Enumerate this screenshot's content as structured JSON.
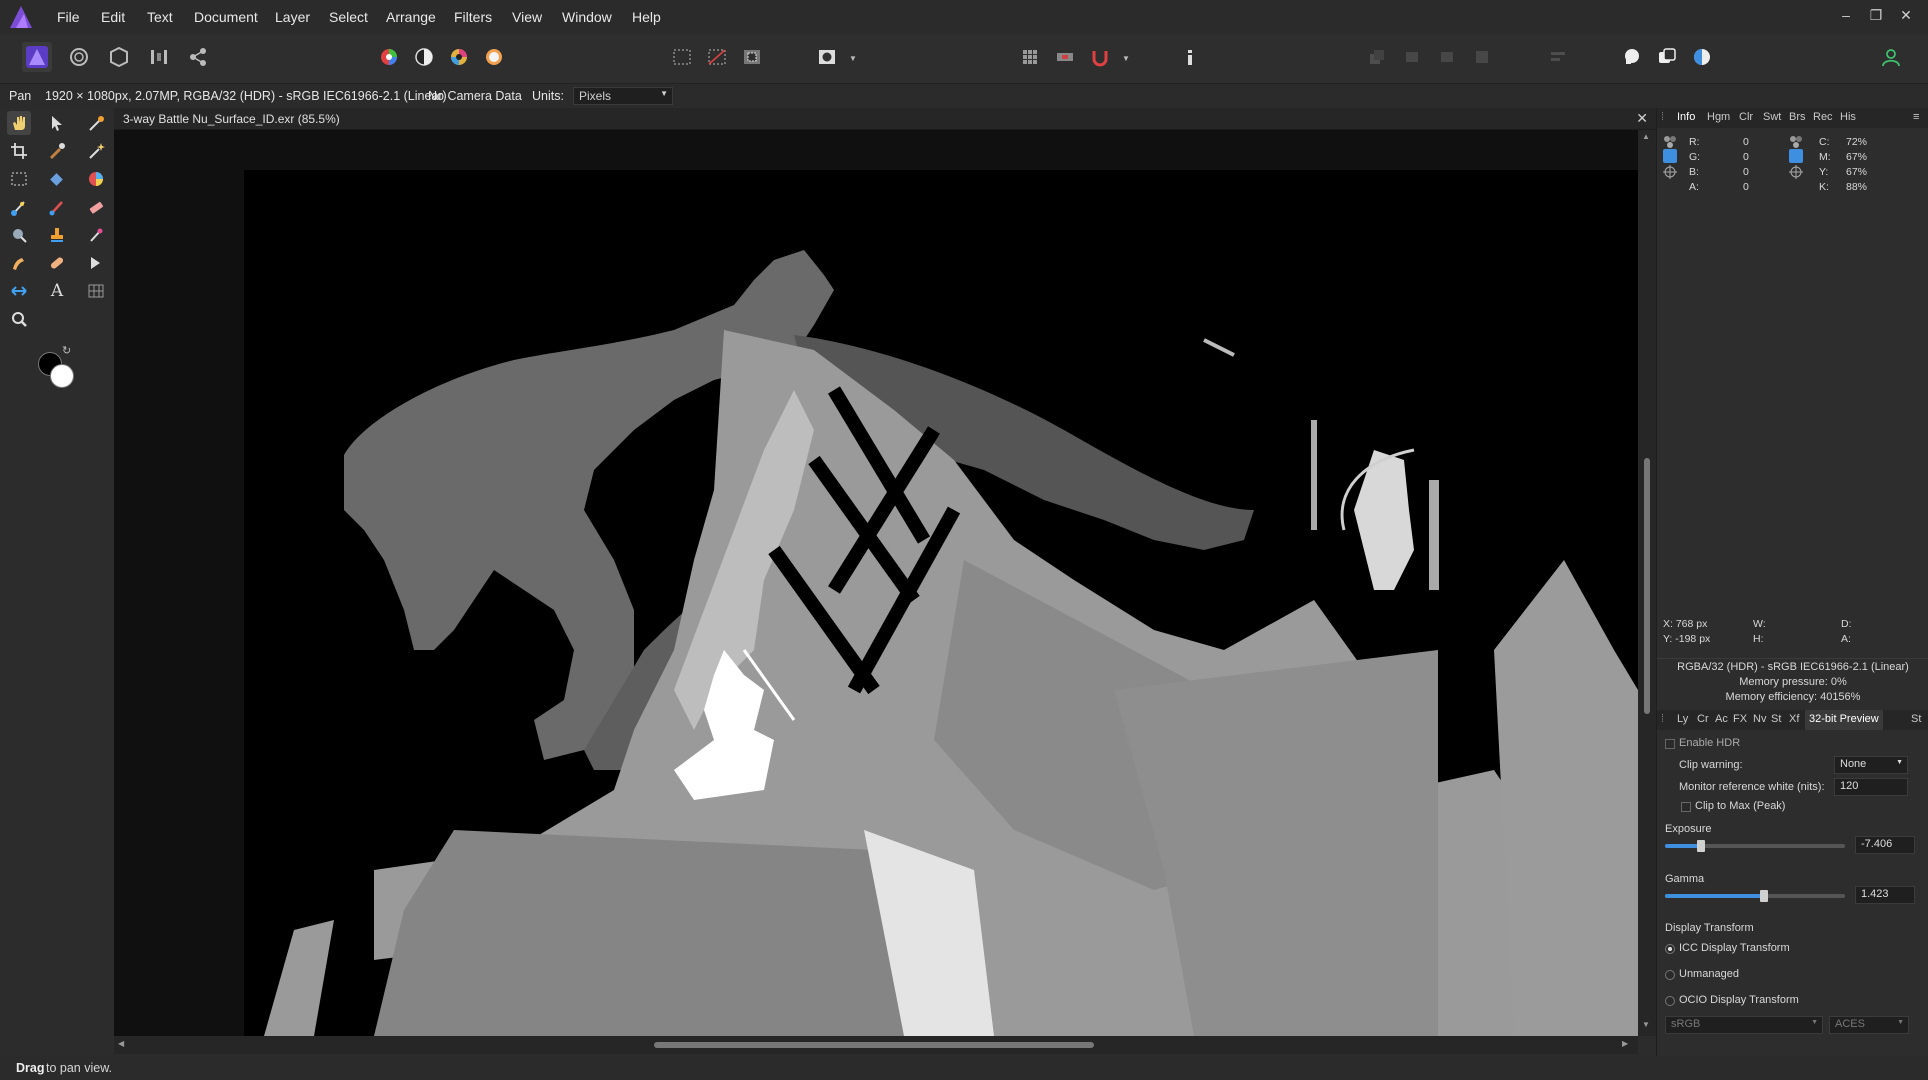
{
  "menubar": {
    "items": [
      "File",
      "Edit",
      "Text",
      "Document",
      "Layer",
      "Select",
      "Arrange",
      "Filters",
      "View",
      "Window",
      "Help"
    ]
  },
  "window_controls": {
    "minimize": "–",
    "restore": "❐",
    "close": "✕"
  },
  "contextbar": {
    "tool": "Pan",
    "doc_info": "1920 × 1080px, 2.07MP, RGBA/32 (HDR) - sRGB IEC61966-2.1 (Linear)",
    "camera": "No Camera Data",
    "units_label": "Units:",
    "units_value": "Pixels"
  },
  "document": {
    "tab_title": "3-way Battle Nu_Surface_ID.exr (85.5%)",
    "close": "✕"
  },
  "info_panel": {
    "tabs": [
      "Info",
      "Hgm",
      "Clr",
      "Swt",
      "Brs",
      "Rec",
      "His"
    ],
    "active_tab": "Info",
    "rgba": [
      {
        "label": "R:",
        "value": "0"
      },
      {
        "label": "G:",
        "value": "0"
      },
      {
        "label": "B:",
        "value": "0"
      },
      {
        "label": "A:",
        "value": "0"
      }
    ],
    "cmyk": [
      {
        "label": "C:",
        "value": "72%"
      },
      {
        "label": "M:",
        "value": "67%"
      },
      {
        "label": "Y:",
        "value": "67%"
      },
      {
        "label": "K:",
        "value": "88%"
      }
    ],
    "x": "X: 768 px",
    "y": "Y: -198 px",
    "w": "W:",
    "h": "H:",
    "d": "D:",
    "a": "A:",
    "format": "RGBA/32 (HDR) - sRGB IEC61966-2.1 (Linear)",
    "memory_pressure": "Memory pressure: 0%",
    "memory_efficiency": "Memory efficiency: 40156%"
  },
  "preview_panel": {
    "tabs": [
      "Ly",
      "Cr",
      "Ac",
      "FX",
      "Nv",
      "St",
      "Xf",
      "32-bit Preview",
      "St"
    ],
    "active_tab": "32-bit Preview",
    "enable_hdr": "Enable HDR",
    "clip_warning_label": "Clip warning:",
    "clip_warning_value": "None",
    "monitor_label": "Monitor reference white (nits):",
    "monitor_value": "120",
    "clip_to_max": "Clip to Max (Peak)",
    "exposure_label": "Exposure",
    "exposure_value": "-7.406",
    "exposure_level": 0.2,
    "gamma_label": "Gamma",
    "gamma_value": "1.423",
    "gamma_level": 0.55,
    "display_transform_label": "Display Transform",
    "radio_icc": "ICC Display Transform",
    "radio_unmanaged": "Unmanaged",
    "radio_ocio": "OCIO Display Transform",
    "ocio_left": "sRGB",
    "ocio_right": "ACES"
  },
  "statusbar": {
    "bold": "Drag",
    "rest": " to pan view."
  },
  "colors": {
    "accent": "#3f8fe0",
    "brand": "#7b4dd6"
  }
}
